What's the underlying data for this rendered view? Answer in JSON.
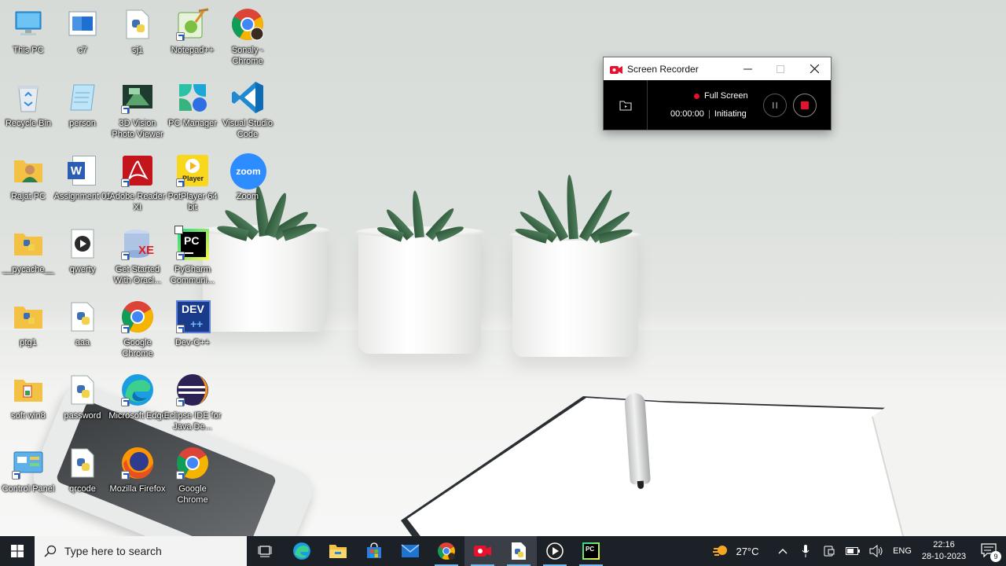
{
  "desktop": {
    "icons": [
      {
        "label": "This PC"
      },
      {
        "label": "c7"
      },
      {
        "label": "sj1"
      },
      {
        "label": "Notepad++"
      },
      {
        "label": "Sonaly - Chrome"
      },
      {
        "label": "Recycle Bin"
      },
      {
        "label": "person"
      },
      {
        "label": "3D Vision Photo Viewer"
      },
      {
        "label": "PC Manager"
      },
      {
        "label": "Visual Studio Code"
      },
      {
        "label": "Rajat PC"
      },
      {
        "label": "Assignment 01"
      },
      {
        "label": "Adobe Reader XI"
      },
      {
        "label": "PotPlayer 64 bit"
      },
      {
        "label": "Zoom"
      },
      {
        "label": "__pycache__"
      },
      {
        "label": "qwerty"
      },
      {
        "label": "Get Started With Oracl..."
      },
      {
        "label": "PyCharm Communi..."
      },
      {
        "label": "ptg1"
      },
      {
        "label": "aaa"
      },
      {
        "label": "Google Chrome"
      },
      {
        "label": "Dev-C++"
      },
      {
        "label": "soft win8"
      },
      {
        "label": "password"
      },
      {
        "label": "Microsoft Edge"
      },
      {
        "label": "Eclipse IDE for Java De..."
      },
      {
        "label": "Control Panel"
      },
      {
        "label": "qrcode"
      },
      {
        "label": "Mozilla Firefox"
      },
      {
        "label": "Google Chrome"
      }
    ],
    "icon_text": {
      "word": "W",
      "zoom": "zoom",
      "potplayer": "Player",
      "pycharm": "PC",
      "devcpp": "DEV",
      "devcpp_plus": "++",
      "oracle": "XE"
    }
  },
  "recorder": {
    "title": "Screen Recorder",
    "mode": "Full Screen",
    "timer": "00:00:00",
    "status": "Initiating",
    "accent": "#e8112d"
  },
  "taskbar": {
    "search_placeholder": "Type here to search",
    "weather": "27°C",
    "language": "ENG",
    "time": "22:16",
    "date": "28-10-2023",
    "notification_count": "9",
    "pycharm_text": "PC"
  }
}
